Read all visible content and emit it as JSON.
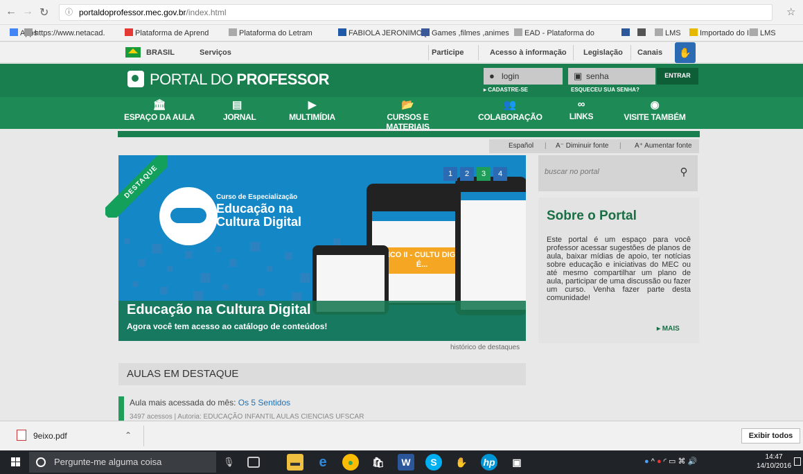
{
  "browser": {
    "url_host": "portaldoprofessor.mec.gov.br",
    "url_path": "/index.html"
  },
  "bookmarks": [
    {
      "label": "Apps",
      "icon": "apps-icon",
      "color": "#4285f4"
    },
    {
      "label": "https://www.netacad.",
      "icon": "netacad-icon",
      "color": "#999999"
    },
    {
      "label": "Plataforma de Aprend",
      "icon": "play-icon",
      "color": "#e53935"
    },
    {
      "label": "Plataforma do Letram",
      "icon": "moodle-icon",
      "color": "#aaaaaa"
    },
    {
      "label": "FABIOLA JERONIMO [",
      "icon": "flag-icon",
      "color": "#1e5aa8"
    },
    {
      "label": "Games ,filmes ,animes",
      "icon": "facebook-icon",
      "color": "#3b5998"
    },
    {
      "label": "EAD - Plataforma do",
      "icon": "moodle-icon",
      "color": "#aaaaaa"
    },
    {
      "label": "",
      "icon": "word-icon",
      "color": "#2b579a"
    },
    {
      "label": "",
      "icon": "globe-icon",
      "color": "#555555"
    },
    {
      "label": "LMS",
      "icon": "page-icon",
      "color": "#aaaaaa"
    },
    {
      "label": "Importado do IE",
      "icon": "folder-icon",
      "color": "#e6b800"
    },
    {
      "label": "LMS",
      "icon": "page-icon",
      "color": "#aaaaaa"
    }
  ],
  "govbar": {
    "brasil": "BRASIL",
    "servicos": "Serviços",
    "participe": "Participe",
    "acesso": "Acesso à informação",
    "legislacao": "Legislação",
    "canais": "Canais"
  },
  "header": {
    "logo_light": "PORTAL DO ",
    "logo_bold": "PROFESSOR",
    "login_placeholder": "login",
    "senha_placeholder": "senha",
    "entrar": "ENTRAR",
    "cadastre": "▸ CADASTRE-SE",
    "esqueceu": "ESQUECEU SUA SENHA?"
  },
  "nav": [
    {
      "label": "ESPAÇO DA AULA",
      "icon": "building-icon",
      "glyph": "🏛"
    },
    {
      "label": "JORNAL",
      "icon": "newspaper-icon",
      "glyph": "▤"
    },
    {
      "label": "MULTIMÍDIA",
      "icon": "play-icon",
      "glyph": "▶"
    },
    {
      "label": "CURSOS E MATERIAIS",
      "icon": "folder-icon",
      "glyph": "📂"
    },
    {
      "label": "COLABORAÇÃO",
      "icon": "people-icon",
      "glyph": "👥"
    },
    {
      "label": "LINKS",
      "icon": "link-icon",
      "glyph": "∞"
    },
    {
      "label": "VISITE TAMBÉM",
      "icon": "eye-icon",
      "glyph": "◉"
    }
  ],
  "lang": {
    "espanol": "Español",
    "diminuir": "A⁻  Diminuir fonte",
    "aumentar": "A⁺  Aumentar fonte"
  },
  "hero": {
    "ribbon": "DESTAQUE",
    "course_small": "Curso de Especialização",
    "course_big": "Educação na Cultura Digital",
    "pages": [
      "1",
      "2",
      "3",
      "4"
    ],
    "active_page": "3",
    "topic_text": "TÓPICO II - CULTU DIGITAL É...",
    "title": "Educação na Cultura Digital",
    "subtitle": "Agora você tem acesso ao catálogo de conteúdos!",
    "historico": "histórico de destaques"
  },
  "search": {
    "placeholder": "buscar no portal"
  },
  "sobre": {
    "title": "Sobre o Portal",
    "text": "Este portal é um espaço para você professor acessar sugestões de planos de aula, baixar mídias de apoio, ter notícias sobre educação e iniciativas do MEC ou até mesmo compartilhar um plano de aula, participar de uma discussão ou fazer um curso. Venha fazer parte desta comunidade!",
    "mais": "▸ MAIS"
  },
  "aulas": {
    "heading": "AULAS EM DESTAQUE",
    "label": "Aula mais acessada do mês: ",
    "link": "Os 5 Sentidos",
    "meta": "3497 acessos  |  Autoria: EDUCAÇÃO INFANTIL AULAS CIENCIAS UFSCAR"
  },
  "downloads": {
    "file": "9eixo.pdf",
    "show_all": "Exibir todos"
  },
  "taskbar": {
    "search": "Pergunte-me alguma coisa",
    "time": "14:47",
    "date": "14/10/2016"
  },
  "colors": {
    "portal_green": "#1a7f4e",
    "nav_green": "#1e8a55",
    "hero_blue": "#1487c7",
    "link_blue": "#1f6fb2"
  }
}
